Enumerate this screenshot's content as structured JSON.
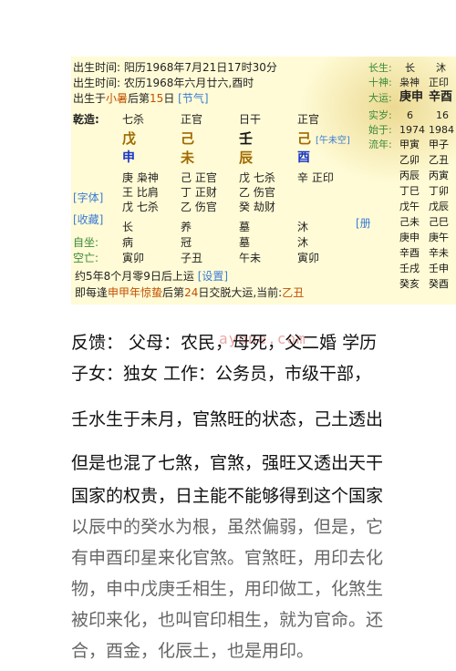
{
  "chart": {
    "line1": "出生时间: 阳历1968年7月21日17时30分",
    "line2": "出生时间: 农历1968年六月廿六,酉时",
    "line3_pre": "出生于",
    "line3_term": "小暑",
    "line3_mid": "后第",
    "line3_num": "15",
    "line3_day": "日",
    "line3_tag": "[节气]",
    "qianzao": "乾造:",
    "top_gods": [
      "七杀",
      "正官",
      "日干",
      "正官"
    ],
    "stems": [
      "戊",
      "己",
      "壬",
      "己"
    ],
    "stem_tag": "[午未空]",
    "branches": [
      "申",
      "未",
      "辰",
      "酉"
    ],
    "hidden": [
      [
        "庚 枭神",
        "王 比肩",
        "戊 七杀"
      ],
      [
        "己 正官",
        "丁 正财",
        "乙 伤官"
      ],
      [
        "戊 七杀",
        "乙 伤官",
        "癸 劫财"
      ],
      [
        "辛 正印"
      ]
    ],
    "side_tags": [
      "[字体]",
      "[收藏]"
    ],
    "right_tag": "[册",
    "row_changsheng": [
      "长",
      "养",
      "墓",
      "沐"
    ],
    "label_zizuo": "自坐:",
    "row_zizuo": [
      "病",
      "冠",
      "墓",
      "沐"
    ],
    "label_kongwang": "空亡:",
    "row_kongwang": [
      "寅卯",
      "子丑",
      "午未",
      "寅卯"
    ],
    "yun1": "约5年8个月零9日后上运",
    "yun1_tag": "[设置]",
    "yun2_a": "即每逢",
    "yun2_b": "申甲年",
    "yun2_c": "惊蛰",
    "yun2_d": "后第",
    "yun2_e": "24",
    "yun2_f": "日交脱大运,当前:",
    "yun2_g": "乙丑"
  },
  "right_panel": {
    "r1_label": "长生:",
    "r1": [
      "长",
      "沐"
    ],
    "r2_label": "十神:",
    "r2": [
      "枭神",
      "正印"
    ],
    "r3_label": "大运:",
    "r3": [
      "庚申",
      "辛酉"
    ],
    "r4_label": "实岁:",
    "r4": [
      "6",
      "16"
    ],
    "r5_label": "始于:",
    "r5": [
      "1974",
      "1984"
    ],
    "r6_label": "流年:",
    "liunian": [
      [
        "甲寅",
        "甲子"
      ],
      [
        "乙卯",
        "乙丑"
      ],
      [
        "丙辰",
        "丙寅"
      ],
      [
        "丁巳",
        "丁卯"
      ],
      [
        "戊午",
        "戊辰"
      ],
      [
        "己未",
        "己巳"
      ],
      [
        "庚申",
        "庚午"
      ],
      [
        "辛酉",
        "辛未"
      ],
      [
        "壬戌",
        "壬申"
      ],
      [
        "癸亥",
        "癸酉"
      ]
    ]
  },
  "watermark": "ayone.com",
  "body": {
    "p1": "反馈： 父母：农民，母死，父二婚  学历",
    "p2": "子女：独女  工作：公务员，市级干部，",
    "p3": "壬水生于未月，官煞旺的状态，己土透出",
    "p4": "但是也混了七煞，官煞，强旺又透出天干",
    "p5": "国家的权贵，日主能不能够得到这个国家",
    "p6": "以辰中的癸水为根，虽然偏弱，但是，它",
    "p7": "有申酉印星来化官煞。官煞旺，用印去化",
    "p8": "物，申中戊庚壬相生，用印做工，化煞生",
    "p9": "被印来化，也叫官印相生，就为官命。还",
    "p10": "合，酉金，化辰土，也是用印。"
  }
}
